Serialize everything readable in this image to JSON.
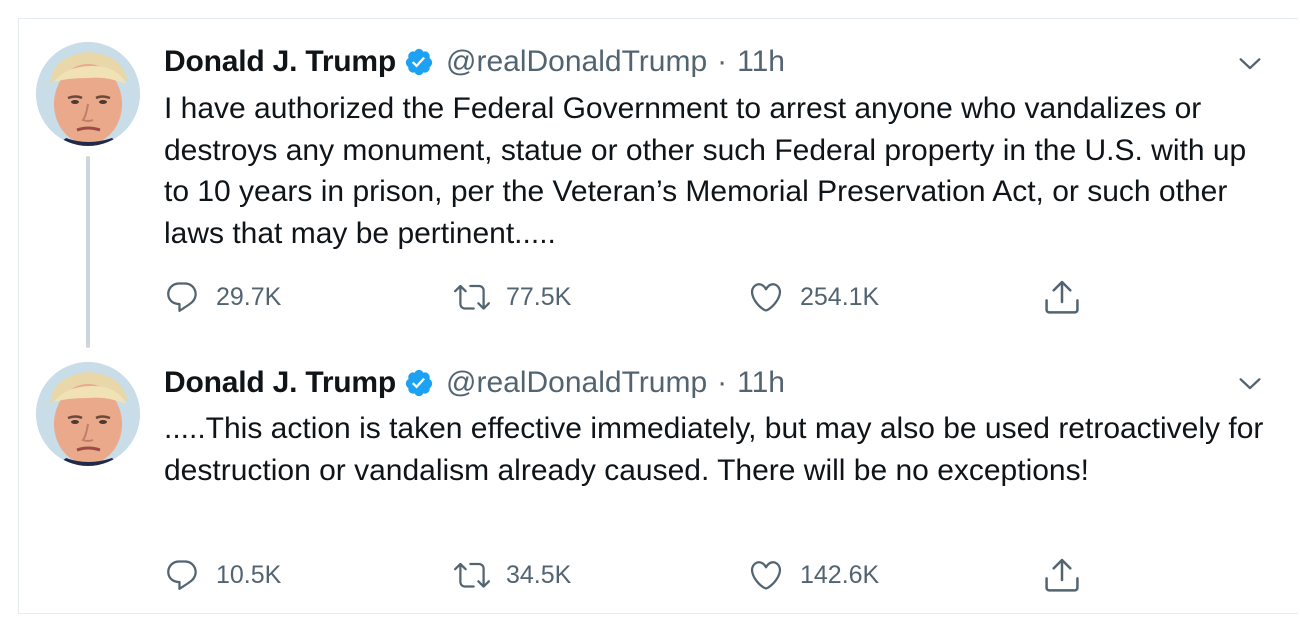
{
  "tweets": [
    {
      "author_name": "Donald J. Trump",
      "handle": "@realDonaldTrump",
      "separator": "·",
      "time": "11h",
      "text": "I have authorized the Federal Government to arrest anyone who vandalizes or destroys any monument, statue or other such Federal property in the U.S. with up to 10 years in prison, per the Veteran’s Memorial Preservation Act, or such other laws that may be pertinent.....",
      "replies": "29.7K",
      "retweets": "77.5K",
      "likes": "254.1K"
    },
    {
      "author_name": "Donald J. Trump",
      "handle": "@realDonaldTrump",
      "separator": "·",
      "time": "11h",
      "text": ".....This action is taken effective immediately, but may also be used retroactively for destruction or vandalism already caused. There will be no exceptions!",
      "replies": "10.5K",
      "retweets": "34.5K",
      "likes": "142.6K"
    }
  ],
  "icons": {
    "verified": "verified-badge-icon",
    "caret": "chevron-down-icon",
    "reply": "reply-icon",
    "retweet": "retweet-icon",
    "like": "heart-icon",
    "share": "share-icon"
  },
  "colors": {
    "verified_blue": "#1da1f2",
    "text": "#0f1419",
    "secondary": "#536471",
    "thread_line": "#ccd6dd",
    "border": "#e6ecf0"
  }
}
